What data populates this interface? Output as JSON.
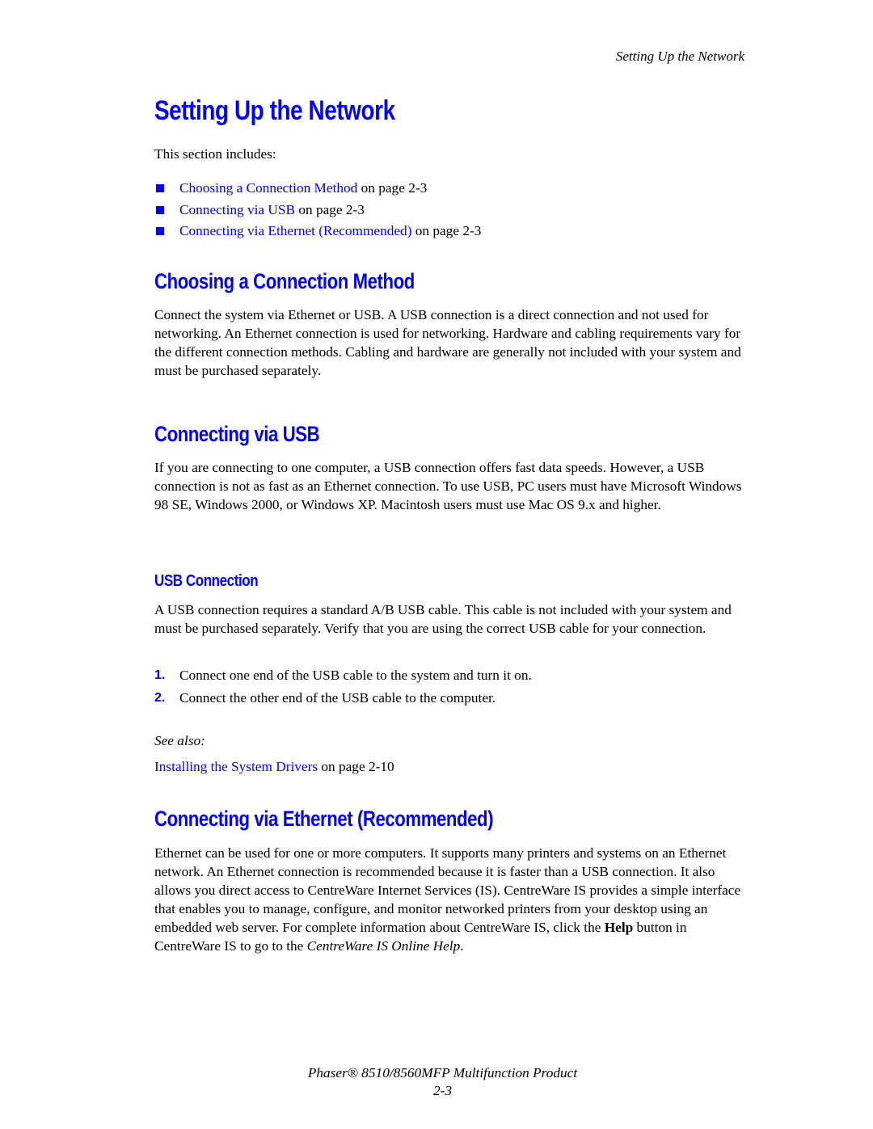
{
  "header": {
    "running_title": "Setting Up the Network"
  },
  "page_title": "Setting Up the Network",
  "intro": "This section includes:",
  "toc": [
    {
      "link": "Choosing a Connection Method",
      "suffix": " on page 2-3"
    },
    {
      "link": "Connecting via USB",
      "suffix": " on page 2-3"
    },
    {
      "link": "Connecting via Ethernet (Recommended)",
      "suffix": " on page 2-3"
    }
  ],
  "sections": {
    "choosing": {
      "heading": "Choosing a Connection Method",
      "body": "Connect the system via Ethernet or USB. A USB connection is a direct connection and not used for networking. An Ethernet connection is used for networking. Hardware and cabling requirements vary for the different connection methods. Cabling and hardware are generally not included with your system and must be purchased separately."
    },
    "usb": {
      "heading": "Connecting via USB",
      "body": "If you are connecting to one computer, a USB connection offers fast data speeds. However, a USB connection is not as fast as an Ethernet connection. To use USB, PC users must have Microsoft Windows 98 SE, Windows 2000, or Windows XP. Macintosh users must use Mac OS 9.x and higher.",
      "subsection": {
        "heading": "USB Connection",
        "body": "A USB connection requires a standard A/B USB cable. This cable is not included with your system and must be purchased separately. Verify that you are using the correct USB cable for your connection.",
        "steps": [
          {
            "num": "1.",
            "text": "Connect one end of the USB cable to the system and turn it on."
          },
          {
            "num": "2.",
            "text": "Connect the other end of the USB cable to the computer."
          }
        ],
        "see_also_label": "See also:",
        "see_also_link": "Installing the System Drivers",
        "see_also_suffix": " on page 2-10"
      }
    },
    "ethernet": {
      "heading": "Connecting via Ethernet (Recommended)",
      "body_before_bold": "Ethernet can be used for one or more computers. It supports many printers and systems on an Ethernet network. An Ethernet connection is recommended because it is faster than a USB connection. It also allows you direct access to CentreWare Internet Services (IS). CentreWare IS provides a simple interface that enables you to manage, configure, and monitor networked printers from your desktop using an embedded web server. For complete information about CentreWare IS, click the ",
      "body_bold": "Help",
      "body_after_bold": " button in CentreWare IS to go to the ",
      "body_italic": "CentreWare IS Online Help",
      "body_end": "."
    }
  },
  "footer": {
    "product": "Phaser® 8510/8560MFP Multifunction Product",
    "page_number": "2-3"
  },
  "colors": {
    "accent": "#0000ff",
    "text": "#000000"
  }
}
